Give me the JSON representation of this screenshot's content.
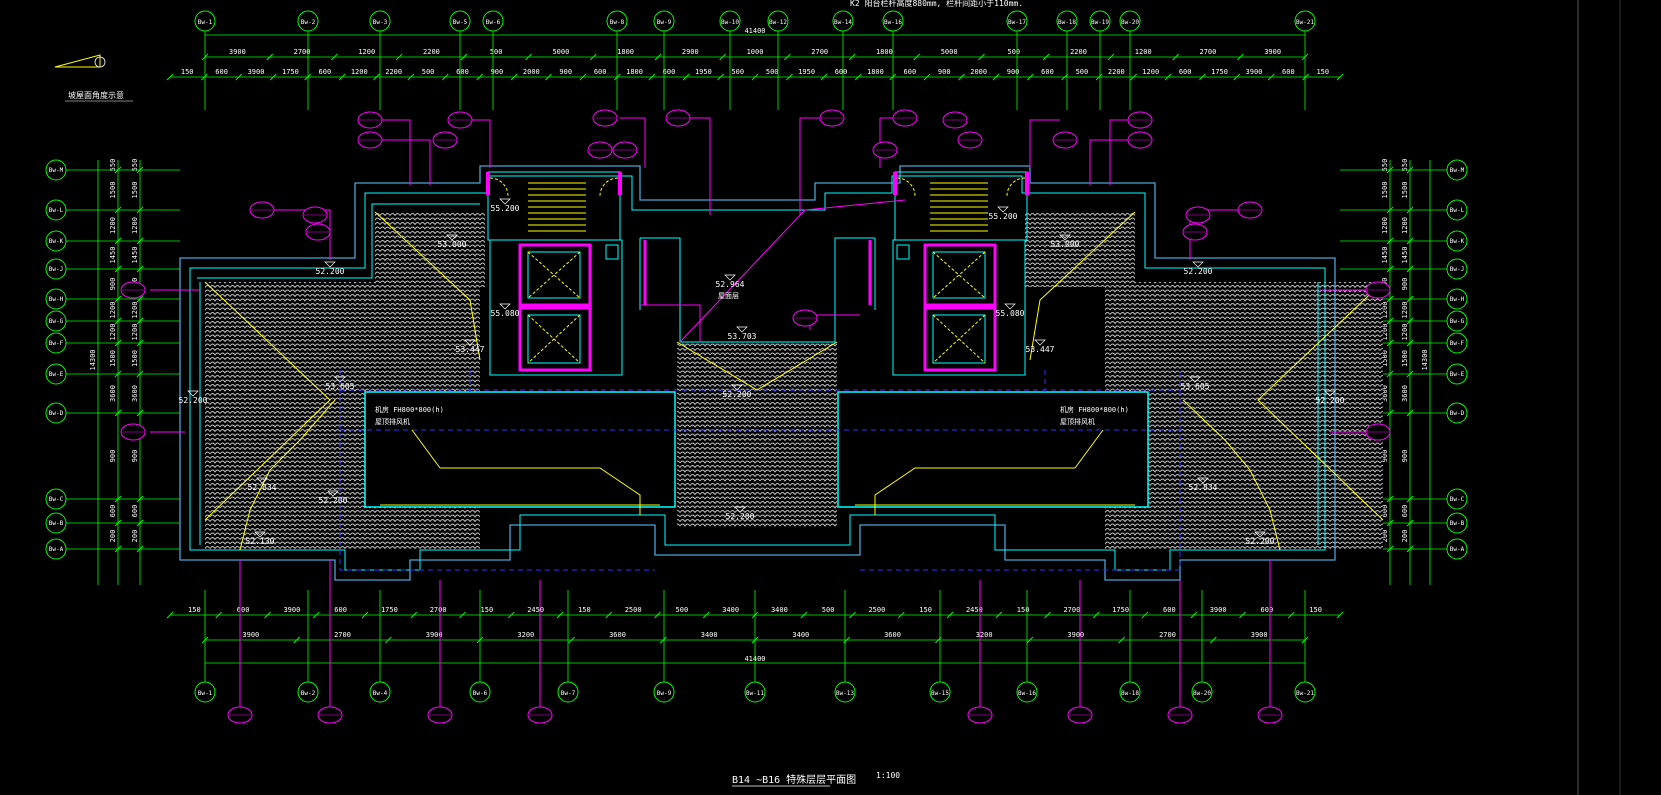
{
  "drawing": {
    "title": "B14 ~B16 特殊层层平面图",
    "scale": "1:100",
    "top_note": "K2 阳台栏杆高度880mm, 栏杆间距小于110mm.",
    "section_label": "坡屋面角度示意",
    "total_width_dim": "41400",
    "side_height_dim": "14300"
  },
  "grid_axes": {
    "top": [
      "Bw-1",
      "Bw-2",
      "Bw-3",
      "Bw-5",
      "Bw-6",
      "Bw-8",
      "Bw-9",
      "Bw-10",
      "Bw-12",
      "Bw-14",
      "Bw-16",
      "Bw-17",
      "Bw-18",
      "Bw-19",
      "Bw-20",
      "Bw-21"
    ],
    "bottom": [
      "Bw-1",
      "Bw-2",
      "Bw-4",
      "Bw-6",
      "Bw-7",
      "Bw-9",
      "Bw-11",
      "Bw-13",
      "Bw-15",
      "Bw-16",
      "Bw-18",
      "Bw-20",
      "Bw-21"
    ],
    "left": [
      "Bw-M",
      "Bw-L",
      "Bw-K",
      "Bw-J",
      "Bw-H",
      "Bw-G",
      "Bw-F",
      "Bw-E",
      "Bw-D",
      "Bw-C",
      "Bw-B",
      "Bw-A"
    ],
    "right": [
      "Bw-M",
      "Bw-L",
      "Bw-K",
      "Bw-J",
      "Bw-H",
      "Bw-G",
      "Bw-F",
      "Bw-E",
      "Bw-D",
      "Bw-C",
      "Bw-B",
      "Bw-A"
    ]
  },
  "dimensions": {
    "top_row1": [
      "3900",
      "2700",
      "1200",
      "2200",
      "500",
      "5000",
      "1800",
      "2900",
      "1000",
      "2700",
      "1800",
      "5000",
      "500",
      "2200",
      "1200",
      "2700",
      "3900"
    ],
    "top_row2": [
      "150",
      "600",
      "3900",
      "1750",
      "600",
      "1200",
      "2200",
      "500",
      "600",
      "900",
      "2000",
      "900",
      "600",
      "1800",
      "600",
      "1950",
      "500",
      "500",
      "1950",
      "600",
      "1800",
      "600",
      "900",
      "2000",
      "900",
      "600",
      "500",
      "2200",
      "1200",
      "600",
      "1750",
      "3900",
      "600",
      "150"
    ],
    "bottom_row1": [
      "150",
      "600",
      "3900",
      "600",
      "1750",
      "2700",
      "150",
      "2450",
      "150",
      "2500",
      "500",
      "3400",
      "3400",
      "500",
      "2500",
      "150",
      "2450",
      "150",
      "2700",
      "1750",
      "600",
      "3900",
      "600",
      "150"
    ],
    "bottom_row2": [
      "3900",
      "2700",
      "3900",
      "3200",
      "3600",
      "3400",
      "3400",
      "3600",
      "3200",
      "3900",
      "2700",
      "3900"
    ],
    "left_col": [
      "550",
      "1500",
      "1200",
      "1450",
      "900",
      "1200",
      "1200",
      "1500",
      "3600",
      "900",
      "600",
      "200"
    ],
    "right_col": [
      "550",
      "1500",
      "1200",
      "1450",
      "900",
      "1200",
      "1200",
      "1500",
      "3600",
      "900",
      "600",
      "200"
    ]
  },
  "elevations": [
    "55.200",
    "53.000",
    "52.200",
    "55.080",
    "53.447",
    "53.605",
    "52.200",
    "52.834",
    "52.200",
    "52.130",
    "52.964",
    "53.703",
    "52.200",
    "52.200",
    "55.200",
    "53.000",
    "52.200",
    "55.080",
    "53.447",
    "53.605",
    "52.200",
    "52.834",
    "52.200"
  ],
  "notes": {
    "equip_left": "机房 FH800*800(h)",
    "equip_right": "机房 FH800*800(h)",
    "equip_sub_left": "屋顶排风机",
    "equip_sub_right": "屋顶排风机",
    "center_label": "屋面层"
  },
  "colors": {
    "grid": "#00ff00",
    "wall": "#00ffff",
    "wall_inner": "#4aa3d6",
    "magenta": "#ff00ff",
    "yellow": "#ffff00",
    "tile": "#c8c8c8",
    "blue_dash": "#3030ff",
    "white": "#ffffff"
  }
}
